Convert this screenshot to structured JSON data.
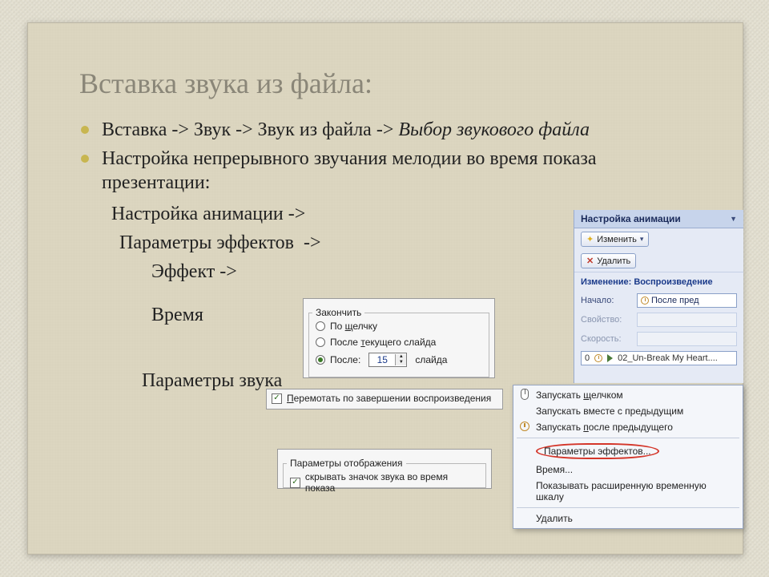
{
  "title": "Вставка звука из файла:",
  "bullets": {
    "b1a": "Вставка -> Звук -> Звук из файла -> ",
    "b1b": "Выбор звукового файла",
    "b2": "Настройка непрерывного  звучания мелодии во время показа презентации:"
  },
  "lines": {
    "l1": "Настройка анимации ->",
    "l2": "Параметры эффектов  ->",
    "l3": "Эффект ->",
    "l4": "Время",
    "l5": "Параметры звука"
  },
  "effect_panel": {
    "legend": "Закончить",
    "opt1": "По щелчку",
    "opt2": "После текущего слайда",
    "opt3a": "После:",
    "opt3_val": "15",
    "opt3b": "слайда"
  },
  "time_panel": {
    "check": "Перемотать по завершении воспроизведения"
  },
  "sound_panel": {
    "legend": "Параметры отображения",
    "check": "скрывать значок звука во время показа"
  },
  "taskpane": {
    "header": "Настройка анимации",
    "btn_change": "Изменить",
    "btn_delete": "Удалить",
    "section": "Изменение: Воспроизведение",
    "lbl_start": "Начало:",
    "val_start": "После пред",
    "lbl_prop": "Свойство:",
    "lbl_speed": "Скорость:",
    "item_index": "0",
    "item_name": "02_Un-Break My Heart...."
  },
  "ctxmenu": {
    "m1": "Запускать щелчком",
    "m2": "Запускать вместе с предыдущим",
    "m3": "Запускать после предыдущего",
    "m4": "Параметры эффектов...",
    "m5": "Время...",
    "m6": "Показывать расширенную временную шкалу",
    "m7": "Удалить"
  }
}
